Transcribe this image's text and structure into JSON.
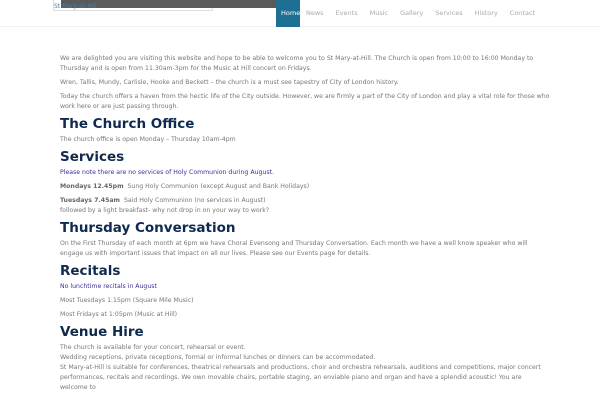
{
  "header": {
    "logo": "St Mary-at-Hill"
  },
  "nav": [
    "Home",
    "News",
    "Events",
    "Music",
    "Gallery",
    "Services",
    "History",
    "Contact"
  ],
  "intro": [
    "We are delighted you are visiting this website and hope to be able to welcome you to St Mary-at-Hill. The Church is open from 10:00 to 16:00 Monday to Thursday and is open from 11.30am-3pm for the Music at Hill concert on Fridays.",
    "Wren, Tallis, Mundy, Carlisle, Hooke and Beckett – the church is a must see tapestry of City of London history.",
    "Today the church offers a haven from the hectic life of the City outside. However, we are firmly a part of the City of London and play a vital role for those who work here or are just passing through."
  ],
  "office": {
    "title": "The Church Office",
    "text": "The church office is open Monday – Thursday 10am-4pm"
  },
  "services": {
    "title": "Services",
    "note": "Please note there are no services of Holy Communion during August.",
    "mon_label": "Mondays 12.45pm",
    "mon_text": "Sung Holy Communion (except August and Bank Holidays)",
    "tue_label": "Tuesdays 7.45am",
    "tue_text": "Said Holy Communion (no services in August)",
    "tue_text2": "followed by a light breakfast- why not drop in on your way to work?"
  },
  "thursday": {
    "title": "Thursday Conversation",
    "text": "On the First Thursday of each month at 6pm we have Choral Evensong and Thursday Conversation. Each month we have a well know speaker who will engage us with important issues that impact on all our lives. Please see our Events page for details."
  },
  "recitals": {
    "title": "Recitals",
    "note": "No lunchtime recitals in August",
    "line1": "Most Tuesdays 1.15pm (Square Mile Music)",
    "line2": "Most Fridays at 1:05pm (Music at Hill)"
  },
  "venue": {
    "title": "Venue Hire",
    "line1": "The church is available for your concert, rehearsal or event.",
    "line2": "Wedding receptions, private receptions, formal or informal lunches or dinners can be accommodated.",
    "line3": "St Mary-at-Hill is suitable for conferences, theatrical rehearsals and productions, choir and orchestra rehearsals, auditions and competitions, major concert performances, recitals and recordings. We own movable chairs, portable staging, an enviable piano and organ and have a splendid acoustic! You are welcome to"
  }
}
